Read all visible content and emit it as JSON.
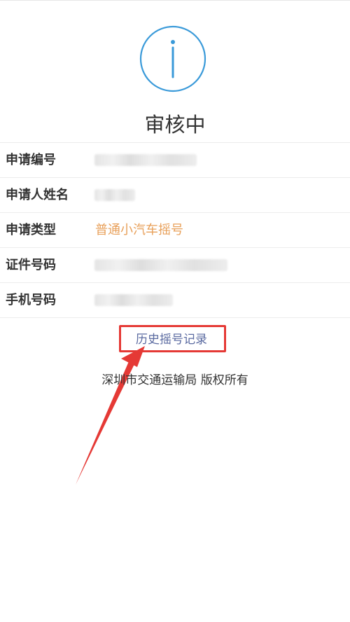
{
  "status": {
    "icon": "info-icon",
    "icon_color": "#3a9ad9",
    "title": "审核中"
  },
  "info": {
    "rows": [
      {
        "label": "申请编号",
        "value": "",
        "value_redacted": true
      },
      {
        "label": "申请人姓名",
        "value": "",
        "value_redacted": true
      },
      {
        "label": "申请类型",
        "value": "普通小汽车摇号",
        "value_color": "#e8a05a"
      },
      {
        "label": "证件号码",
        "value": "",
        "value_redacted": true
      },
      {
        "label": "手机号码",
        "value": "",
        "value_redacted": true
      }
    ]
  },
  "history_link": {
    "label": "历史摇号记录"
  },
  "annotation": {
    "highlight_color": "#e53935"
  },
  "footer": {
    "text": "深圳市交通运输局 版权所有"
  }
}
